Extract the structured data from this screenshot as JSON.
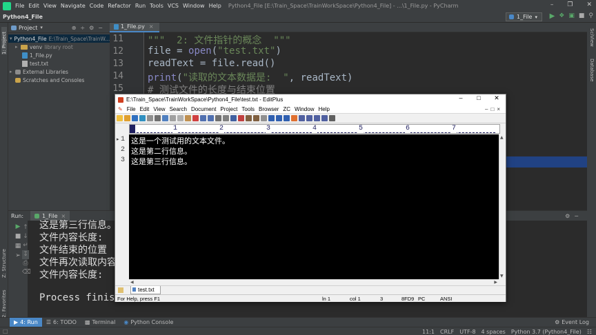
{
  "pycharm": {
    "menu": [
      "File",
      "Edit",
      "View",
      "Navigate",
      "Code",
      "Refactor",
      "Run",
      "Tools",
      "VCS",
      "Window",
      "Help"
    ],
    "window_title": "Python4_File [E:\\Train_Space\\TrainWorkSpace\\Python4_File] - ...\\1_File.py - PyCharm",
    "project_name": "Python4_File",
    "run_config": "1_File",
    "left_stripe": {
      "project": "1: Project",
      "structure": "Z: Structure",
      "favorites": "2: Favorites"
    },
    "right_stripe": {
      "sciview": "SciView",
      "database": "Database"
    },
    "project_panel": {
      "title": "Project",
      "items": [
        {
          "label": "Python4_File",
          "extra": "E:\\Train_Space\\TrainW..."
        },
        {
          "label": "venv",
          "extra": "library root"
        },
        {
          "label": "1_File.py"
        },
        {
          "label": "test.txt"
        },
        {
          "label": "External Libraries"
        },
        {
          "label": "Scratches and Consoles"
        }
      ]
    },
    "editor_tab": "1_File.py",
    "editor": {
      "line_numbers": [
        "11",
        "12",
        "13",
        "14",
        "15",
        "",
        "",
        "",
        "",
        "",
        "2",
        "2"
      ],
      "code": {
        "l11": "\"\"\"  2: 文件指针的概念  \"\"\"",
        "l12_a": "file = ",
        "l12_fn": "open",
        "l12_b": "(",
        "l12_str": "\"test.txt\"",
        "l12_c": ")",
        "l13": "readText = file.read()",
        "l14_fn": "print",
        "l14_a": "(",
        "l14_str": "\"读取的文本数据是:  \"",
        "l14_b": ", readText)",
        "l15": "# 测试文件的长度与结束位置"
      }
    },
    "run_panel": {
      "header_label": "Run:",
      "tab_label": "1_File",
      "output": [
        "这是第三行信息。",
        "文件内容长度:",
        "文件结束的位置",
        "文件再次读取内容",
        "文件内容长度:",
        "",
        "Process finish"
      ]
    },
    "bottom_tools": [
      {
        "label": "4: Run",
        "active": true
      },
      {
        "label": "6: TODO"
      },
      {
        "label": "Terminal"
      },
      {
        "label": "Python Console"
      }
    ],
    "event_log": "Event Log",
    "status": {
      "position": "11:1",
      "line_sep": "CRLF",
      "encoding": "UTF-8",
      "indent": "4 spaces",
      "interpreter": "Python 3.7 (Python4_File)"
    }
  },
  "editplus": {
    "title": "E:\\Train_Space\\TrainWorkSpace\\Python4_File\\test.txt - EditPlus",
    "menu": [
      "File",
      "Edit",
      "View",
      "Search",
      "Document",
      "Project",
      "Tools",
      "Browser",
      "ZC",
      "Window",
      "Help"
    ],
    "ruler_numbers": [
      "1",
      "2",
      "3",
      "4",
      "5",
      "6",
      "7"
    ],
    "line_numbers": [
      "1",
      "2",
      "3"
    ],
    "lines": [
      "这是一个测试用的文本文件。",
      "这是第二行信息。",
      "这是第三行信息。"
    ],
    "doc_tab": "test.txt",
    "status": {
      "help": "For Help, press F1",
      "line": "ln 1",
      "col": "col 1",
      "value": "3",
      "code": "8FD9",
      "pc": "PC",
      "encoding": "ANSI"
    }
  },
  "colors": {
    "pycharm_bg": "#2b2b2b",
    "pycharm_panel": "#3c3f41",
    "selection": "#214283",
    "run_active": "#4a88c7",
    "string_green": "#6a8759",
    "editplus_bg": "#000000"
  }
}
